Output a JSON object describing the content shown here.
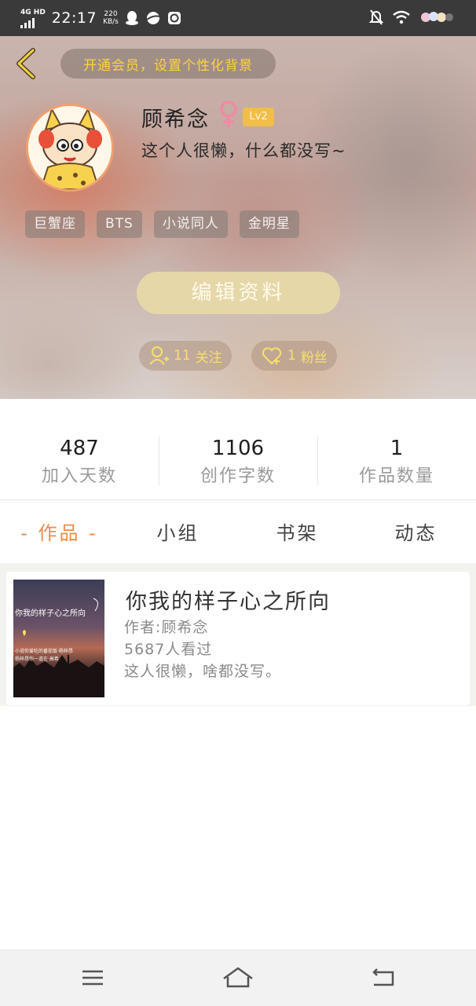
{
  "status_bar": {
    "network": "4G HD",
    "time": "22:17",
    "speed_value": "220",
    "speed_unit": "KB/s",
    "icons": [
      "qq-icon",
      "planet-icon",
      "app-icon",
      "mute-bell-icon",
      "wifi-icon",
      "battery-icon"
    ]
  },
  "header": {
    "vip_banner": "开通会员，设置个性化背景",
    "nickname": "顾希念",
    "gender": "female",
    "level": "Lv2",
    "bio": "这个人很懒，什么都没写~",
    "tags": [
      "巨蟹座",
      "BTS",
      "小说同人",
      "金明星"
    ],
    "edit_button": "编辑资料",
    "follow_count": "11",
    "follow_label": "关注",
    "fans_count": "1",
    "fans_label": "粉丝",
    "accent_color": "#ffd23a"
  },
  "stats": [
    {
      "value": "487",
      "label": "加入天数"
    },
    {
      "value": "1106",
      "label": "创作字数"
    },
    {
      "value": "1",
      "label": "作品数量"
    }
  ],
  "tabs": [
    {
      "label": "- 作品 -",
      "active": true
    },
    {
      "label": "小组",
      "active": false
    },
    {
      "label": "书架",
      "active": false
    },
    {
      "label": "动态",
      "active": false
    }
  ],
  "works": [
    {
      "title": "你我的样子心之所向",
      "author": "作者:顾希念",
      "views": "5687人看过",
      "description": "这人很懒，啥都没写。",
      "cover_text_line1": "你我的样子心之所向",
      "cover_text_line2": "小说你爱吃的番茄饭·杨梓昂",
      "cover_text_line3": "杨梓昂你一道在·高希"
    }
  ],
  "navbar": {
    "icons": [
      "menu-icon",
      "home-icon",
      "back-icon"
    ]
  },
  "colors": {
    "tab_active": "#ef8a48",
    "level_badge": "#f2be4a",
    "edit_button": "#e6d7a9"
  }
}
